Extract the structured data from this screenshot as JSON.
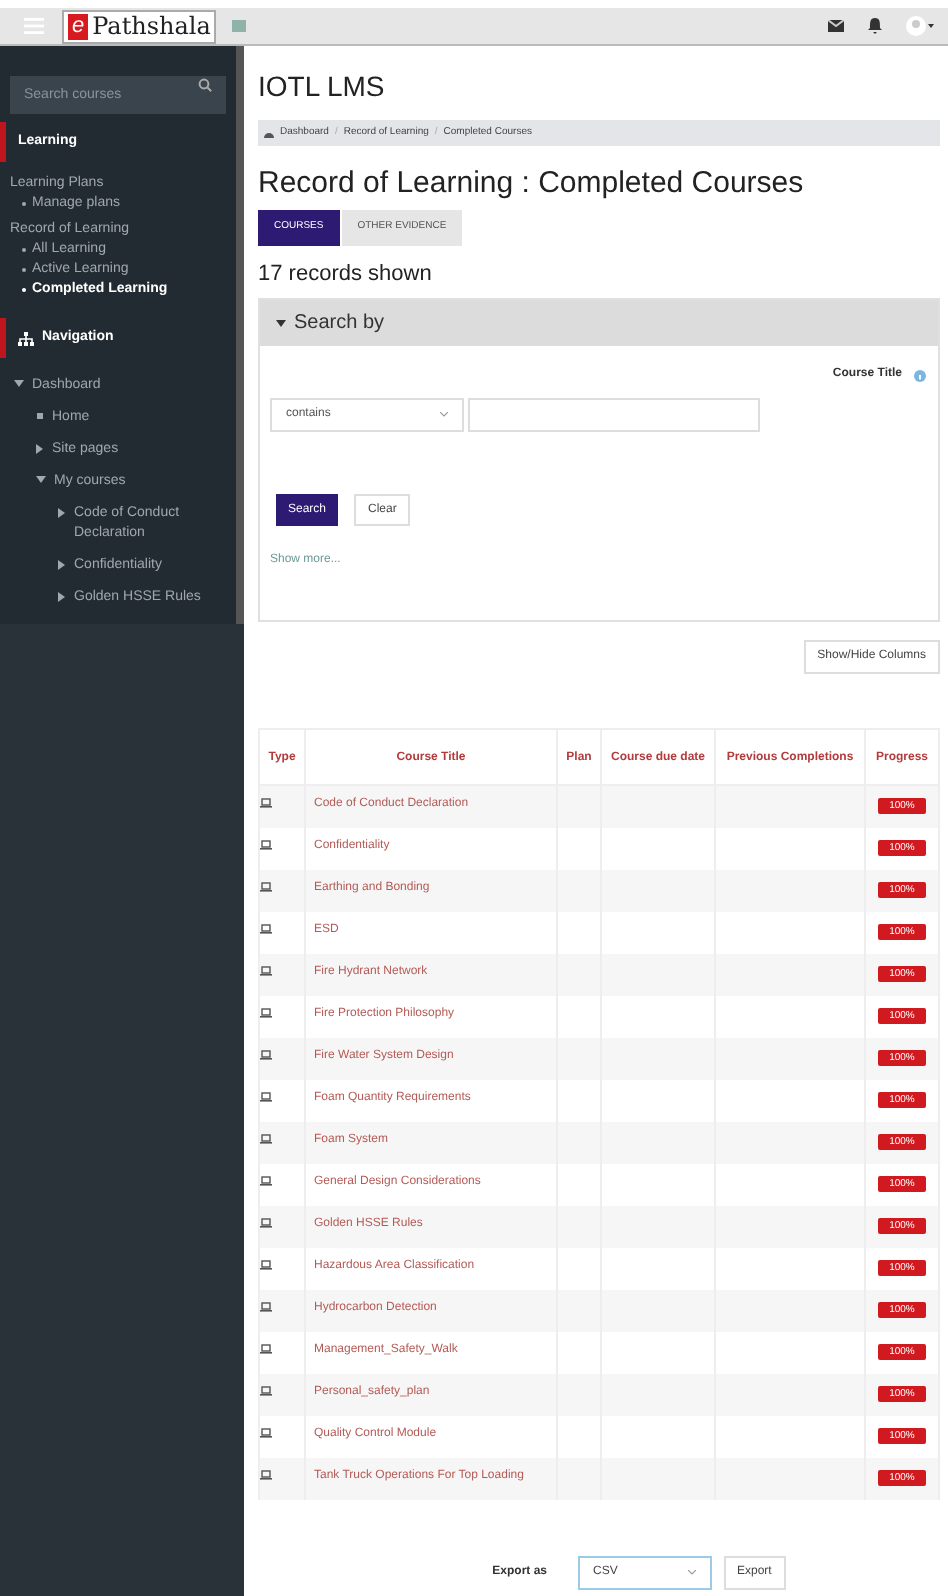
{
  "navbar": {
    "logo_letter": "e",
    "logo_text": "Pathshala"
  },
  "sidebar": {
    "search": {
      "placeholder": "Search courses"
    },
    "sections": [
      {
        "title": "Learning",
        "groups": [
          {
            "label": "Learning Plans",
            "items": [
              {
                "label": "Manage plans",
                "selected": false
              }
            ]
          },
          {
            "label": "Record of Learning",
            "items": [
              {
                "label": "All Learning",
                "selected": false
              },
              {
                "label": "Active Learning",
                "selected": false
              },
              {
                "label": "Completed Learning",
                "selected": true
              }
            ]
          }
        ]
      },
      {
        "title": "Navigation",
        "tree": [
          {
            "label": "Dashboard",
            "expanded": true,
            "kind": "branch",
            "children": [
              {
                "label": "Home",
                "kind": "leaf"
              },
              {
                "label": "Site pages",
                "kind": "branch",
                "expanded": false
              },
              {
                "label": "My courses",
                "kind": "branch",
                "expanded": true,
                "children": [
                  {
                    "label": "Code of Conduct Declaration",
                    "kind": "branch",
                    "expanded": false
                  },
                  {
                    "label": "Confidentiality",
                    "kind": "branch",
                    "expanded": false
                  },
                  {
                    "label": "Golden HSSE Rules",
                    "kind": "branch",
                    "expanded": false
                  }
                ]
              }
            ]
          }
        ]
      }
    ]
  },
  "main": {
    "site_title": "IOTL LMS",
    "breadcrumb": {
      "separator": "/",
      "items": [
        "Dashboard",
        "Record of Learning",
        "Completed Courses"
      ]
    },
    "heading": "Record of Learning : Completed Courses",
    "tabs": [
      {
        "label": "COURSES",
        "selected": true
      },
      {
        "label": "OTHER EVIDENCE",
        "selected": false
      }
    ],
    "record_count": "17 records shown",
    "search_panel": {
      "title": "Search by",
      "expanded": true,
      "field_label": "Course Title",
      "operator": "contains",
      "search_button": "Search",
      "clear_button": "Clear",
      "show_more": "Show more..."
    },
    "show_hide_button": "Show/Hide Columns",
    "table": {
      "columns": [
        "Type",
        "Course Title",
        "Plan",
        "Course due date",
        "Previous Completions",
        "Progress"
      ],
      "rows": [
        {
          "title": "Code of Conduct Declaration",
          "progress": "100%"
        },
        {
          "title": "Confidentiality",
          "progress": "100%"
        },
        {
          "title": "Earthing and Bonding",
          "progress": "100%"
        },
        {
          "title": "ESD",
          "progress": "100%"
        },
        {
          "title": "Fire Hydrant Network",
          "progress": "100%"
        },
        {
          "title": "Fire Protection Philosophy",
          "progress": "100%"
        },
        {
          "title": "Fire Water System Design",
          "progress": "100%"
        },
        {
          "title": "Foam Quantity Requirements",
          "progress": "100%"
        },
        {
          "title": "Foam System",
          "progress": "100%"
        },
        {
          "title": "General Design Considerations",
          "progress": "100%"
        },
        {
          "title": "Golden HSSE Rules",
          "progress": "100%"
        },
        {
          "title": "Hazardous Area Classification",
          "progress": "100%"
        },
        {
          "title": "Hydrocarbon Detection",
          "progress": "100%"
        },
        {
          "title": "Management_Safety_Walk",
          "progress": "100%"
        },
        {
          "title": "Personal_safety_plan",
          "progress": "100%"
        },
        {
          "title": "Quality Control Module",
          "progress": "100%"
        },
        {
          "title": "Tank Truck Operations For Top Loading",
          "progress": "100%"
        }
      ]
    },
    "export": {
      "label": "Export as",
      "format": "CSV",
      "button": "Export"
    }
  }
}
